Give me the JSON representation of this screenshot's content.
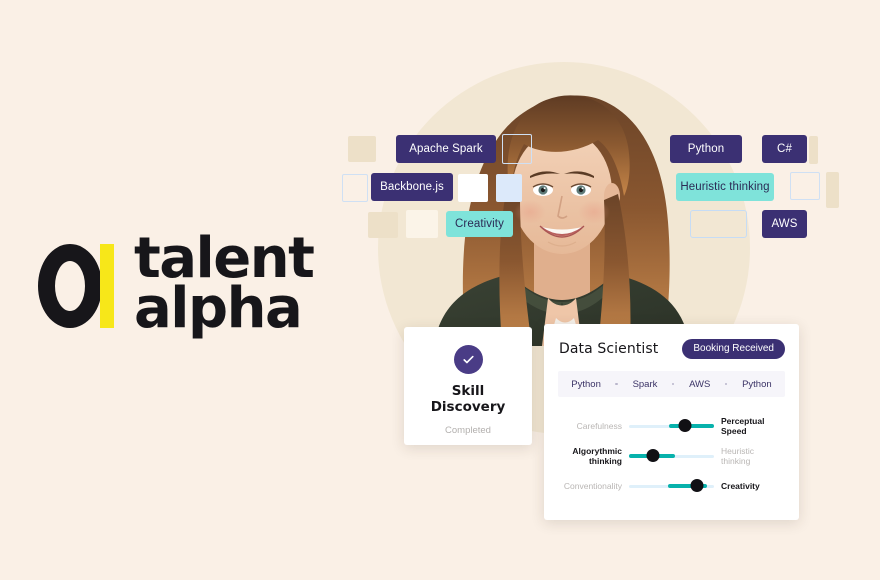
{
  "page": {
    "background_color": "#FAF0E6",
    "circle_color": "#F2E7D3"
  },
  "brand": {
    "name_line1": "talent",
    "name_line2": "alpha",
    "mark_icon": "ring-and-bar-logo",
    "ring_color": "#17161A",
    "bar_color": "#F7E719"
  },
  "portrait": {
    "alt": "smiling woman portrait",
    "icon": "person-photo"
  },
  "skill_tags": [
    {
      "label": "Apache Spark",
      "style": "purple"
    },
    {
      "label": "Backbone.js",
      "style": "purple"
    },
    {
      "label": "Creativity",
      "style": "mint"
    },
    {
      "label": "Python",
      "style": "purple"
    },
    {
      "label": "C#",
      "style": "purple"
    },
    {
      "label": "Heuristic thinking",
      "style": "mint"
    },
    {
      "label": "AWS",
      "style": "purple"
    }
  ],
  "colors": {
    "purple": "#3B3073",
    "mint": "#7FE3DA",
    "teal": "#07B2AC",
    "track": "#DFF0FA",
    "thumb": "#111014",
    "badge_purple": "#4A3C86"
  },
  "skill_card": {
    "icon": "check-circle-icon",
    "title_line1": "Skill",
    "title_line2": "Discovery",
    "status": "Completed"
  },
  "detail_card": {
    "title": "Data Scientist",
    "badge": "Booking Received",
    "chips": [
      "Python",
      "Spark",
      "AWS",
      "Python"
    ],
    "sliders": [
      {
        "left_label": "Carefulness",
        "right_label": "Perceptual Speed",
        "right_label_line1": "Perceptual",
        "right_label_line2": "Speed",
        "value": 66,
        "fill_start": 47,
        "fill_end": 100,
        "emphasis": "right"
      },
      {
        "left_label": "Algorythmic thinking",
        "left_label_line1": "Algorythmic",
        "left_label_line2": "thinking",
        "right_label": "Heuristic thinking",
        "right_label_line1": "Heuristic",
        "right_label_line2": "thinking",
        "value": 28,
        "fill_start": 0,
        "fill_end": 54,
        "emphasis": "left"
      },
      {
        "left_label": "Conventionality",
        "right_label": "Creativity",
        "value": 80,
        "fill_start": 46,
        "fill_end": 92,
        "emphasis": "right"
      }
    ]
  }
}
